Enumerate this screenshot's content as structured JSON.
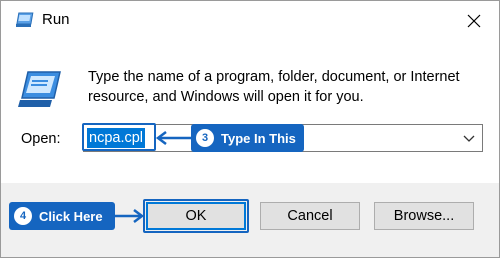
{
  "window": {
    "title": "Run",
    "icon": "run-icon",
    "close_icon": "close-icon"
  },
  "description": "Type the name of a program, folder, document, or Internet resource, and Windows will open it for you.",
  "open_field": {
    "label": "Open:",
    "value": "ncpa.cpl",
    "dropdown_icon": "chevron-down-icon"
  },
  "buttons": {
    "ok": "OK",
    "cancel": "Cancel",
    "browse": "Browse..."
  },
  "annotations": [
    {
      "number": "3",
      "text": "Type In This"
    },
    {
      "number": "4",
      "text": "Click Here"
    }
  ],
  "colors": {
    "callout": "#1565c0",
    "selection": "#0078d7",
    "button_bar": "#f0f0f0"
  }
}
